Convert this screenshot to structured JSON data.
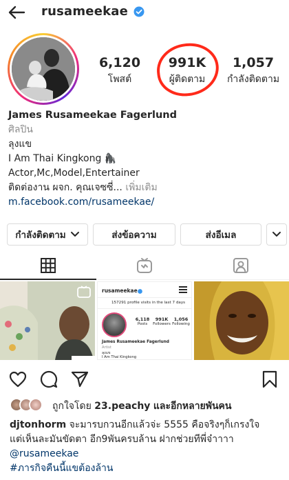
{
  "header": {
    "username": "rusameekae",
    "back_icon": "arrow-left-icon",
    "verified_icon": "verified-badge-icon",
    "verified_color": "#3897f0"
  },
  "stats": {
    "posts": {
      "value": "6,120",
      "label": "โพสต์"
    },
    "followers": {
      "value": "991K",
      "label": "ผู้ติดตาม"
    },
    "following": {
      "value": "1,057",
      "label": "กำลังติดตาม"
    },
    "highlight_color": "#ff2a1a"
  },
  "bio": {
    "name": "James Rusameekae Fagerlund",
    "category": "ศิลปิน",
    "lines": [
      "ลุงแข",
      "I Am Thai Kingkong 🦍",
      "Actor,Mc,Model,Entertainer"
    ],
    "contact": "ติดต่องาน ผจก. คุณเจซซี่...",
    "more": "เพิ่มเติม",
    "link": "m.facebook.com/rusameekae/"
  },
  "buttons": {
    "following": "กำลังติดตาม",
    "message": "ส่งข้อความ",
    "email": "ส่งอีเมล"
  },
  "tabs": {
    "grid_icon": "grid-icon",
    "igtv_icon": "igtv-icon",
    "tagged_icon": "tagged-person-icon",
    "active": "grid"
  },
  "embedded_post": {
    "username": "rusameekae",
    "visits": "157291 profile visits in the last 7 days",
    "posts_num": "6,118",
    "posts_lbl": "Posts",
    "followers_num": "991K",
    "followers_lbl": "Followers",
    "following_num": "1,056",
    "following_lbl": "Following",
    "name": "James Rusameekae Fagerlund",
    "category": "Artist",
    "line1": "ลุงแข",
    "line2": "I Am Thai Kingkong"
  },
  "post_actions": {
    "like_icon": "heart-icon",
    "comment_icon": "comment-icon",
    "share_icon": "paper-plane-icon",
    "save_icon": "bookmark-icon"
  },
  "likes": {
    "prefix": "ถูกใจโดย",
    "user": "23.peachy",
    "suffix": "และอีกหลายพันคน"
  },
  "caption": {
    "user": "djtonhorm",
    "text1": " จะมารบกวนอีกแล้วจ่ะ 5555 คือจริงๆก็เกรงใจ",
    "text2": "แต่เห็นละมันขัดตา อีก9พันครบล้าน ฝากช่วยทีพี่จ๋าาาา",
    "mention": "@rusameekae",
    "hashtag": "#ภารกิจคืนนี้แขต้องล้าน"
  }
}
